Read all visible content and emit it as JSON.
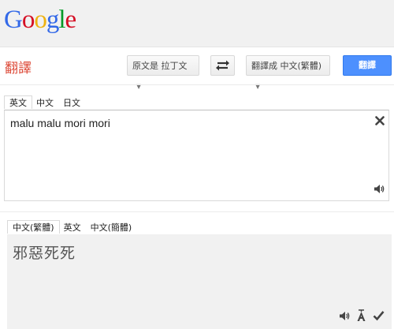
{
  "header": {
    "logo_letters": [
      {
        "ch": "G",
        "color": "#3369e8"
      },
      {
        "ch": "o",
        "color": "#d50f25"
      },
      {
        "ch": "o",
        "color": "#eeb211"
      },
      {
        "ch": "g",
        "color": "#3369e8"
      },
      {
        "ch": "l",
        "color": "#009925"
      },
      {
        "ch": "e",
        "color": "#d50f25"
      }
    ]
  },
  "toolbar": {
    "title": "翻譯",
    "source_lang": "原文是 拉丁文",
    "target_lang": "翻譯成 中文(繁體)",
    "translate_label": "翻譯",
    "swap_icon": "swap-arrows-icon"
  },
  "source": {
    "tabs": [
      "英文",
      "中文",
      "日文"
    ],
    "selected_tab": "英文",
    "text": "malu malu mori mori",
    "icons": [
      "clear-icon",
      "speaker-icon"
    ]
  },
  "result": {
    "tabs": [
      "中文(繁體)",
      "英文",
      "中文(簡體)"
    ],
    "selected_tab": "中文(繁體)",
    "text": "邪惡死死",
    "icons": [
      "speaker-icon",
      "romanize-icon",
      "checkmark-icon"
    ]
  },
  "colors": {
    "accent_blue": "#4d90fe",
    "title_red": "#dd4b39",
    "result_bg": "#f1f1f1"
  }
}
